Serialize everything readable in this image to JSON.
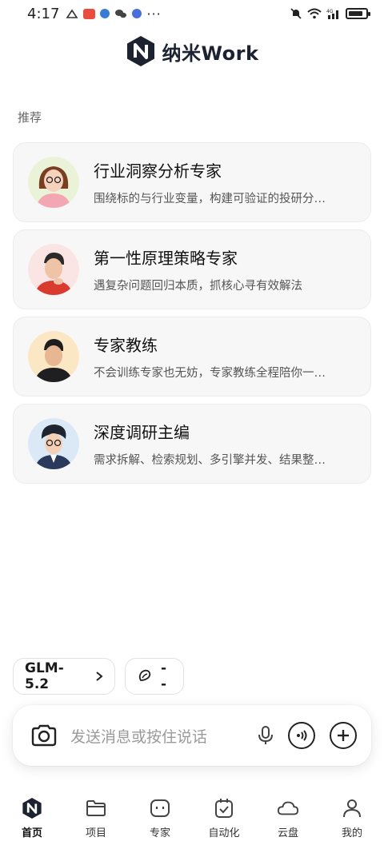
{
  "status_bar": {
    "time": "4:17",
    "network": "4G"
  },
  "header": {
    "app_name": "纳米Work"
  },
  "section": {
    "label": "推荐"
  },
  "experts": [
    {
      "title": "行业洞察分析专家",
      "desc": "围绕标的与行业变量，构建可验证的投研分…"
    },
    {
      "title": "第一性原理策略专家",
      "desc": "遇复杂问题回归本质，抓核心寻有效解法"
    },
    {
      "title": "专家教练",
      "desc": "不会训练专家也无妨，专家教练全程陪你一…"
    },
    {
      "title": "深度调研主编",
      "desc": "需求拆解、检索规划、多引擎并发、结果整…"
    }
  ],
  "model": {
    "name": "GLM-5.2",
    "second": "--"
  },
  "input": {
    "placeholder": "发送消息或按住说话"
  },
  "nav": [
    {
      "label": "首页",
      "icon": "home-logo-icon",
      "active": true
    },
    {
      "label": "项目",
      "icon": "folder-icon"
    },
    {
      "label": "专家",
      "icon": "robot-icon"
    },
    {
      "label": "自动化",
      "icon": "calendar-check-icon"
    },
    {
      "label": "云盘",
      "icon": "cloud-icon"
    },
    {
      "label": "我的",
      "icon": "person-icon"
    }
  ],
  "colors": {
    "accent": "#1c2230",
    "card_bg": "#f7f7f8",
    "text_secondary": "#555555"
  }
}
